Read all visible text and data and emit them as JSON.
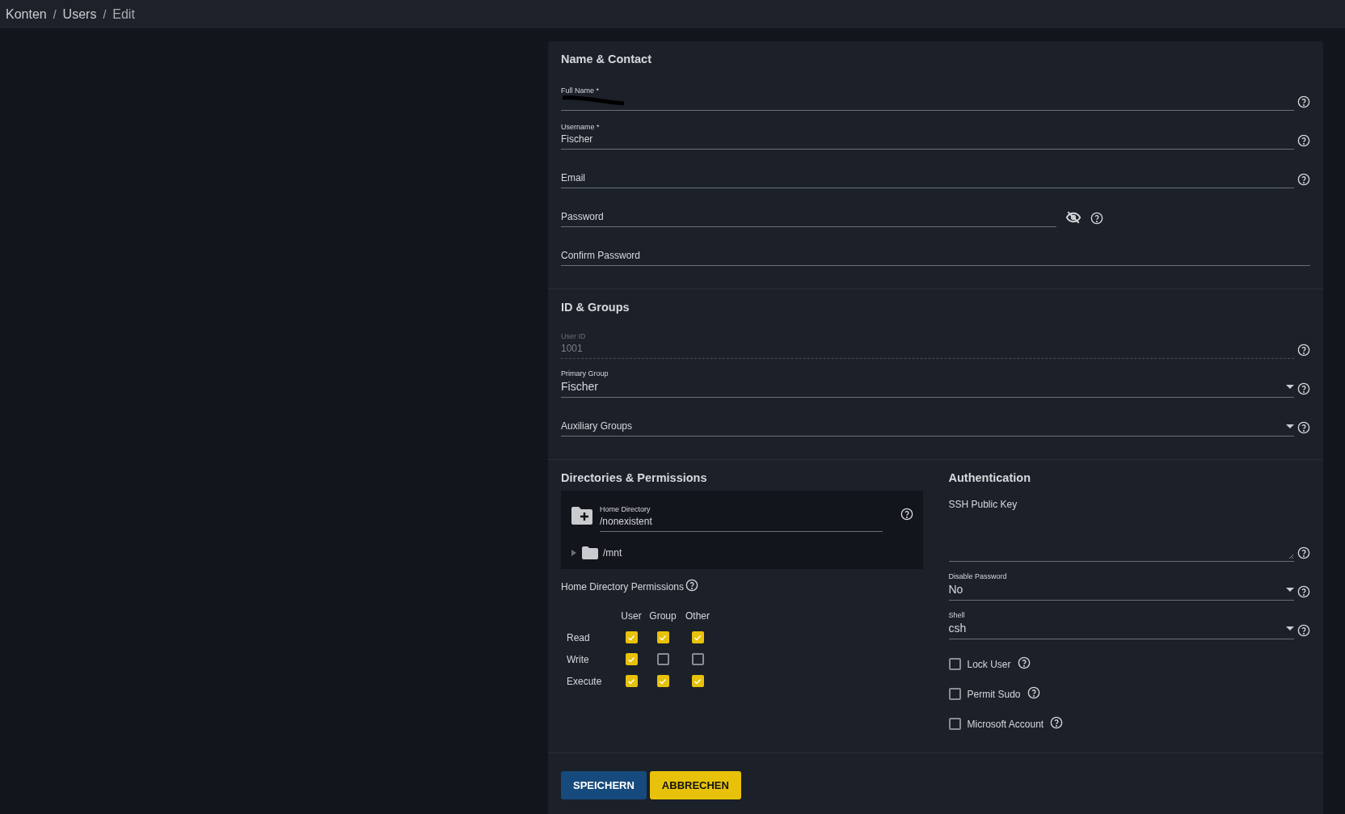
{
  "breadcrumb": [
    {
      "kind": "link",
      "text": "Konten"
    },
    {
      "kind": "separator",
      "text": "/"
    },
    {
      "kind": "link",
      "text": "Users"
    },
    {
      "kind": "separator",
      "text": "/"
    },
    {
      "kind": "current",
      "text": "Edit"
    }
  ],
  "name_contact": {
    "title": "Name & Contact",
    "fields": [
      {
        "kind": "input",
        "label": "Full Name *",
        "redacted": true,
        "help": true
      },
      {
        "kind": "input",
        "label": "Username *",
        "value": "Fischer",
        "help": true
      },
      {
        "kind": "input",
        "label": "Email",
        "help": true
      },
      {
        "kind": "password",
        "label": "Password",
        "help": true
      },
      {
        "kind": "input",
        "label": "Confirm Password",
        "help": false
      }
    ]
  },
  "id_groups": {
    "title": "ID & Groups",
    "fields": [
      {
        "kind": "input",
        "label": "User ID",
        "value": "1001",
        "disabled": true,
        "help": true
      },
      {
        "kind": "select",
        "label": "Primary Group",
        "value": "Fischer",
        "help": true
      },
      {
        "kind": "select",
        "label": "Auxiliary Groups",
        "help": true
      }
    ]
  },
  "directories": {
    "title": "Directories & Permissions",
    "home_directory": {
      "label": "Home Directory",
      "value": "/nonexistent"
    },
    "tree": [
      {
        "name": "/mnt",
        "expanded": false
      }
    ],
    "permissions_label": "Home Directory Permissions",
    "columns": [
      "User",
      "Group",
      "Other"
    ],
    "rows": [
      {
        "label": "Read",
        "checked": [
          true,
          true,
          true
        ]
      },
      {
        "label": "Write",
        "checked": [
          true,
          false,
          false
        ]
      },
      {
        "label": "Execute",
        "checked": [
          true,
          true,
          true
        ]
      }
    ]
  },
  "authentication": {
    "title": "Authentication",
    "ssh_key_label": "SSH Public Key",
    "fields": [
      {
        "kind": "select",
        "label": "Disable Password",
        "value": "No",
        "help": true
      },
      {
        "kind": "select",
        "label": "Shell",
        "value": "csh",
        "help": true
      }
    ],
    "options": [
      {
        "label": "Lock User",
        "checked": false
      },
      {
        "label": "Permit Sudo",
        "checked": false
      },
      {
        "label": "Microsoft Account",
        "checked": false
      }
    ]
  },
  "buttons": [
    {
      "label": "SPEICHERN",
      "kind": "primary"
    },
    {
      "label": "ABBRECHEN",
      "kind": "accent"
    }
  ]
}
